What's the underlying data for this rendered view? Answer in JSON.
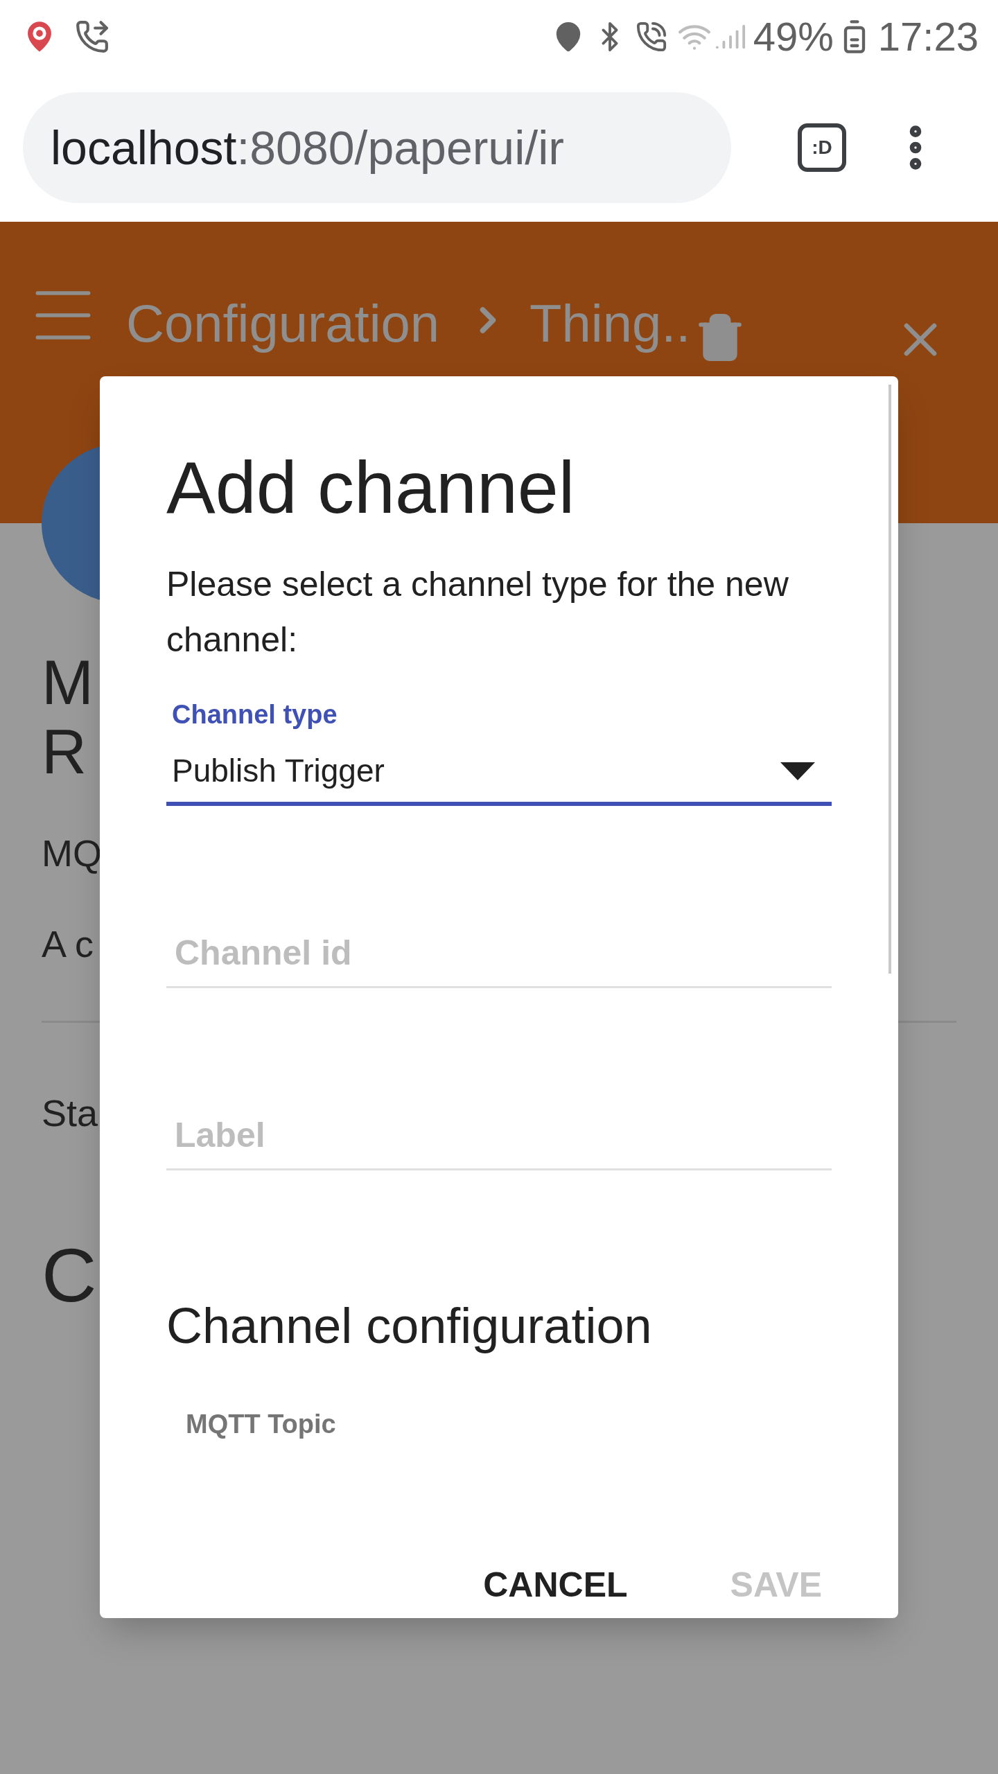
{
  "status_bar": {
    "battery": "49%",
    "time": "17:23"
  },
  "browser": {
    "url_host": "localhost",
    "url_path": ":8080/paperui/ir",
    "tabs_button": ":D"
  },
  "header": {
    "breadcrumbs": [
      "Configuration",
      "Thing.."
    ]
  },
  "background_page": {
    "title_lines": [
      "M",
      "R"
    ],
    "subtitle": "MQ",
    "description": "A c",
    "status": "Sta",
    "section": "C"
  },
  "dialog": {
    "title": "Add channel",
    "message": "Please select a channel type for the new channel:",
    "fields": [
      {
        "kind": "select",
        "label": "Channel type",
        "value": "Publish Trigger",
        "focused": true
      },
      {
        "kind": "input",
        "placeholder": "Channel id",
        "focused": false
      },
      {
        "kind": "input",
        "placeholder": "Label",
        "focused": false
      }
    ],
    "config_title": "Channel configuration",
    "config_field": "MQTT Topic",
    "buttons": [
      {
        "label": "CANCEL",
        "disabled": false
      },
      {
        "label": "SAVE",
        "disabled": true
      }
    ]
  }
}
